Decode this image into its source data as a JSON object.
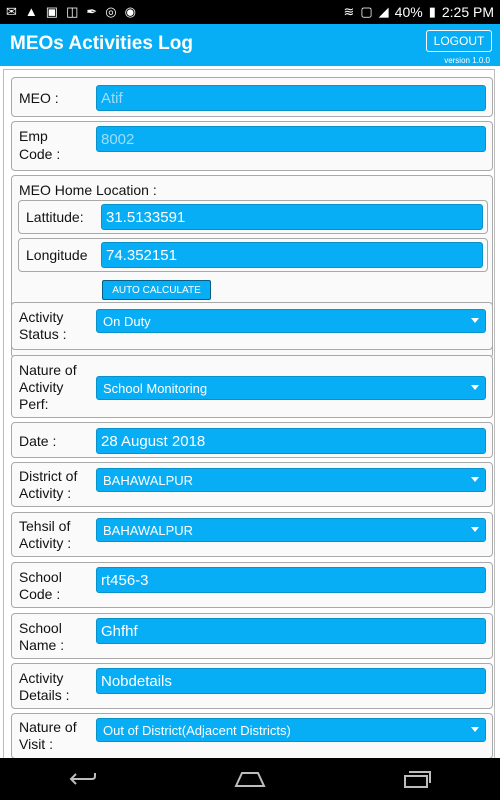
{
  "status_bar": {
    "left_icons": [
      "sms-icon",
      "alert-icon",
      "image-icon",
      "battery-saver-icon",
      "pen-icon",
      "location-icon",
      "game-icon"
    ],
    "battery": "40%",
    "time": "2:25 PM"
  },
  "app_bar": {
    "title": "MEOs Activities Log",
    "logout_label": "LOGOUT",
    "version": "version 1.0.0"
  },
  "form": {
    "meo_label": "MEO :",
    "meo_value": "Atif",
    "emp_code_label_1": "Emp",
    "emp_code_label_2": "Code :",
    "emp_code_value": "8002",
    "home_location_label": "MEO Home Location :",
    "latitude_label": "Lattitude:",
    "latitude_value": "31.5133591",
    "longitude_label": "Longitude",
    "longitude_value": "74.352151",
    "auto_calculate_label": "AUTO CALCULATE",
    "activity_status_label_1": "Activity",
    "activity_status_label_2": "Status :",
    "activity_status_value": "On Duty",
    "nature_activity_label_1": "Nature of",
    "nature_activity_label_2": "Activity",
    "nature_activity_label_3": "Perf:",
    "nature_activity_value": "School Monitoring",
    "date_label": "Date :",
    "date_value": "28 August 2018",
    "district_label_1": "District of",
    "district_label_2": "Activity :",
    "district_value": "BAHAWALPUR",
    "tehsil_label_1": "Tehsil of",
    "tehsil_label_2": "Activity :",
    "tehsil_value": "BAHAWALPUR",
    "school_code_label_1": "School",
    "school_code_label_2": "Code :",
    "school_code_value": "rt456-3",
    "school_name_label_1": "School",
    "school_name_label_2": "Name :",
    "school_name_value": "Ghfhf",
    "activity_details_label_1": "Activity",
    "activity_details_label_2": "Details :",
    "activity_details_value": "Nobdetails",
    "nature_visit_label_1": "Nature of",
    "nature_visit_label_2": "Visit :",
    "nature_visit_value": "Out of District(Adjacent Districts)"
  },
  "colors": {
    "accent": "#08aef5",
    "panel_border": "#a9a9a9"
  }
}
